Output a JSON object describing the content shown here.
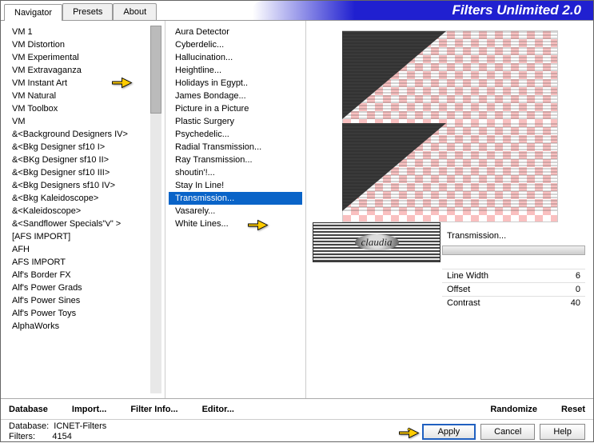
{
  "header": {
    "tabs": [
      "Navigator",
      "Presets",
      "About"
    ],
    "active_tab": 0,
    "title": "Filters Unlimited 2.0"
  },
  "categories": [
    "VM 1",
    "VM Distortion",
    "VM Experimental",
    "VM Extravaganza",
    "VM Instant Art",
    "VM Natural",
    "VM Toolbox",
    "VM",
    "&<Background Designers IV>",
    "&<Bkg Designer sf10 I>",
    "&<BKg Designer sf10 II>",
    "&<Bkg Designer sf10 III>",
    "&<Bkg Designers sf10 IV>",
    "&<Bkg Kaleidoscope>",
    "&<Kaleidoscope>",
    "&<Sandflower Specials\"v\" >",
    "[AFS IMPORT]",
    "AFH",
    "AFS IMPORT",
    "Alf's Border FX",
    "Alf's Power Grads",
    "Alf's Power Sines",
    "Alf's Power Toys",
    "AlphaWorks"
  ],
  "category_pointer_index": 3,
  "filters": [
    "Aura Detector",
    "Cyberdelic...",
    "Hallucination...",
    "Heightline...",
    "Holidays in Egypt..",
    "James Bondage...",
    "Picture in a Picture",
    "Plastic Surgery",
    "Psychedelic...",
    "Radial Transmission...",
    "Ray Transmission...",
    "shoutin'!...",
    "Stay In Line!",
    "Transmission...",
    "Vasarely...",
    "White Lines..."
  ],
  "selected_filter_index": 13,
  "badge_text": "claudia",
  "filter_name": "Transmission...",
  "params": [
    {
      "label": "Line Width",
      "value": "6"
    },
    {
      "label": "Offset",
      "value": "0"
    },
    {
      "label": "Contrast",
      "value": "40"
    }
  ],
  "footer_buttons_left": [
    "Database",
    "Import...",
    "Filter Info...",
    "Editor..."
  ],
  "footer_buttons_right": [
    "Randomize",
    "Reset"
  ],
  "status": {
    "db_label": "Database:",
    "db_value": "ICNET-Filters",
    "flt_label": "Filters:",
    "flt_value": "4154"
  },
  "action_buttons": {
    "apply": "Apply",
    "cancel": "Cancel",
    "help": "Help"
  }
}
